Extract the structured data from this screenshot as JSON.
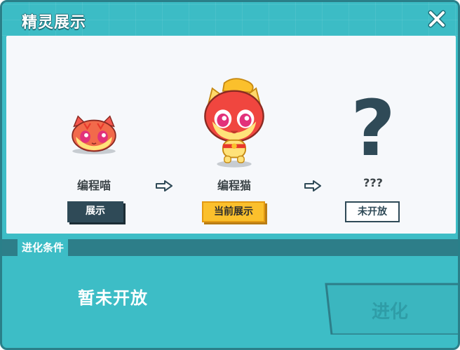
{
  "title": "精灵展示",
  "stages": [
    {
      "name": "编程喵",
      "button": "展示"
    },
    {
      "name": "编程猫",
      "button": "当前展示"
    },
    {
      "name": "???",
      "button": "未开放"
    }
  ],
  "unknown_mark": "?",
  "condition": {
    "label": "进化条件",
    "text": "暂未开放"
  },
  "evolve_button": "进化",
  "colors": {
    "teal": "#3dbdc6",
    "dark_teal": "#2d7e89",
    "panel": "#f6f8fb",
    "button_dark": "#2f4a57",
    "button_current": "#fbc02c"
  },
  "icons": {
    "close": "close-icon",
    "arrow": "arrow-right-icon"
  }
}
